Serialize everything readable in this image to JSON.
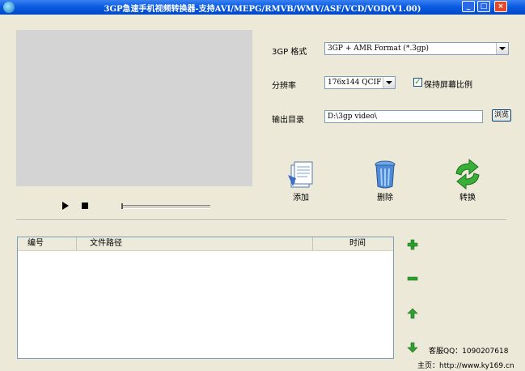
{
  "window": {
    "title": "3GP急速手机视频转换器-支持AVI/MEPG/RMVB/WMV/ASF/VCD/VOD(V1.00)",
    "min_icon": "minimize-icon",
    "max_icon": "maximize-icon",
    "close_icon": "close-icon"
  },
  "player": {
    "play_icon": "play-icon",
    "stop_icon": "stop-icon",
    "progress": 0
  },
  "settings": {
    "format_label": "3GP 格式",
    "format_value": "3GP + AMR Format (*.3gp)",
    "resolution_label": "分辨率",
    "resolution_value": "176x144 QCIF",
    "keep_ratio_label": "保持屏幕比例",
    "keep_ratio_checked": true,
    "output_label": "输出目录",
    "output_value": "D:\\3gp video\\",
    "browse_label": "浏览"
  },
  "actions": {
    "add_label": "添加",
    "delete_label": "删除",
    "convert_label": "转换"
  },
  "table": {
    "columns": [
      "编号",
      "文件路径",
      "时间"
    ],
    "rows": []
  },
  "side": {
    "add_icon": "plus-icon",
    "remove_icon": "minus-icon",
    "up_icon": "arrow-up-icon",
    "down_icon": "arrow-down-icon"
  },
  "footer": {
    "qq": "客服QQ：1090207618",
    "homepage": "主页：http://www.ky169.cn"
  },
  "colors": {
    "titlebar": "#0a5ce0",
    "background": "#ece9d8",
    "accent_green": "#2fa02f"
  }
}
